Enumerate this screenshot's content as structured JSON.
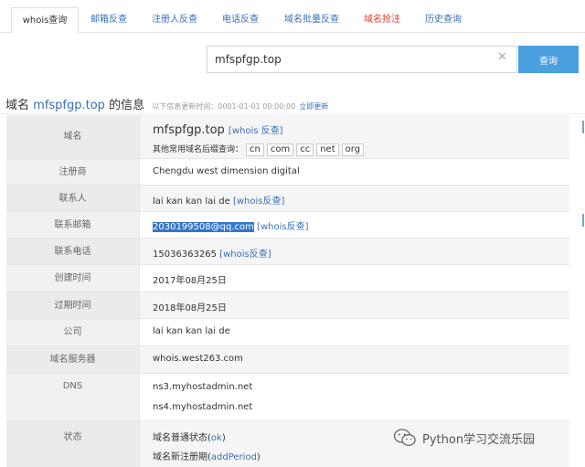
{
  "tabs": [
    {
      "label": "whois查询",
      "active": true
    },
    {
      "label": "邮箱反查"
    },
    {
      "label": "注册人反查"
    },
    {
      "label": "电话反查"
    },
    {
      "label": "域名批量反查"
    },
    {
      "label": "域名抢注",
      "color": "#e0392c"
    },
    {
      "label": "历史查询"
    }
  ],
  "search": {
    "value": "mfspfgp.top",
    "button": "查询",
    "clear": "✕"
  },
  "info": {
    "prefix": "域名",
    "domain": "mfspfgp.top",
    "suffix": "的信息",
    "update_text": "以下信息更新时间：0001-01-01 00:00:00",
    "update_link": "立即更新"
  },
  "rows": {
    "domain": {
      "label": "域名",
      "value": "mfspfgp.top",
      "link": "[whois 反查]",
      "suffix_hint": "其他常用域名后缀查询：",
      "suffixes": [
        "cn",
        "com",
        "cc",
        "net",
        "org"
      ]
    },
    "registrar": {
      "label": "注册商",
      "value": "Chengdu west dimension digital"
    },
    "contact": {
      "label": "联系人",
      "value": "lai kan kan lai de",
      "link": "[whois反查]"
    },
    "email": {
      "label": "联系邮箱",
      "value": "2030199508@qq.com",
      "link": "[whois反查]"
    },
    "phone": {
      "label": "联系电话",
      "value": "15036363265",
      "link": "[whois反查]"
    },
    "created": {
      "label": "创建时间",
      "value": "2017年08月25日"
    },
    "expires": {
      "label": "过期时间",
      "value": "2018年08月25日"
    },
    "company": {
      "label": "公司",
      "value": "lai kan kan lai de"
    },
    "server": {
      "label": "域名服务器",
      "value": "whois.west263.com"
    },
    "dns": {
      "label": "DNS",
      "values": [
        "ns3.myhostadmin.net",
        "ns4.myhostadmin.net"
      ]
    },
    "status": {
      "label": "状态",
      "line1_text": "域名普通状态(",
      "line1_link": "ok",
      "line1_end": ")",
      "line2_text": "域名新注册期(",
      "line2_link": "addPeriod",
      "line2_end": ")"
    }
  },
  "watermark": {
    "text": "Python学习交流乐园",
    "icon": "wechat-icon"
  }
}
